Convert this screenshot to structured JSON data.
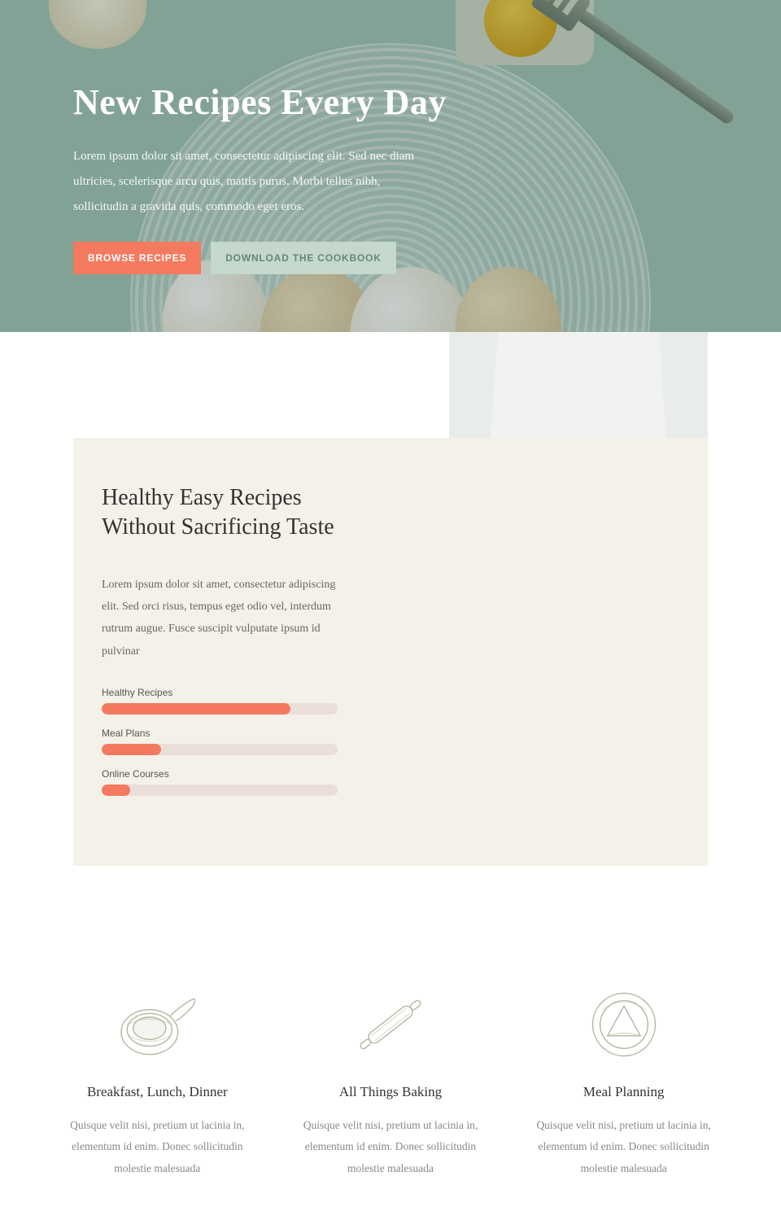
{
  "hero": {
    "title": "New Recipes Every Day",
    "body": "Lorem ipsum dolor sit amet, consectetur adipiscing elit. Sed nec diam ultricies, scelerisque arcu quis, mattis purus. Morbi tellus nibh, sollicitudin a gravida quis, commodo eget eros.",
    "primary_btn": "Browse Recipes",
    "secondary_btn": "Download the Cookbook"
  },
  "about": {
    "title": "Healthy Easy Recipes Without Sacrificing Taste",
    "body": "Lorem ipsum dolor sit amet, consectetur adipiscing elit. Sed orci risus, tempus eget odio vel, interdum rutrum augue. Fusce suscipit vulputate ipsum id pulvinar",
    "bars": [
      {
        "label": "Healthy Recipes",
        "value": 80
      },
      {
        "label": "Meal Plans",
        "value": 25
      },
      {
        "label": "Online Courses",
        "value": 12
      }
    ]
  },
  "features": [
    {
      "title": "Breakfast, Lunch, Dinner",
      "body": "Quisque velit nisi, pretium ut lacinia in, elementum id enim. Donec sollicitudin molestie malesuada"
    },
    {
      "title": "All Things Baking",
      "body": "Quisque velit nisi, pretium ut lacinia in, elementum id enim. Donec sollicitudin molestie malesuada"
    },
    {
      "title": "Meal Planning",
      "body": "Quisque velit nisi, pretium ut lacinia in, elementum id enim. Donec sollicitudin molestie malesuada"
    }
  ],
  "chart_data": {
    "type": "bar",
    "categories": [
      "Healthy Recipes",
      "Meal Plans",
      "Online Courses"
    ],
    "values": [
      80,
      25,
      12
    ],
    "title": "",
    "xlabel": "",
    "ylabel": "",
    "ylim": [
      0,
      100
    ]
  }
}
